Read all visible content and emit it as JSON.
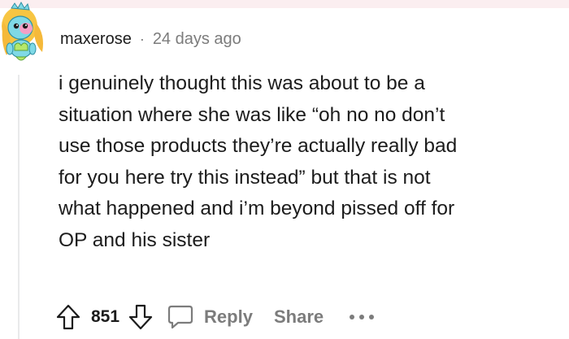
{
  "comment": {
    "username": "maxerose",
    "separator": "·",
    "timestamp": "24 days ago",
    "body": "i genuinely thought this was about to be a\nsituation where she was like “oh no no don’t\nuse those products they’re actually really bad\nfor you here try this instead” but that is not\nwhat happened and i’m beyond pissed off for\nOP and his sister",
    "avatar_icon": "snoo-avatar-icon"
  },
  "actions": {
    "upvote_icon": "upvote-arrow-icon",
    "vote_count": "851",
    "downvote_icon": "downvote-arrow-icon",
    "reply_icon": "speech-bubble-icon",
    "reply_label": "Reply",
    "share_label": "Share",
    "more_icon": "ellipsis-icon"
  },
  "colors": {
    "text_primary": "#1c1c1c",
    "text_muted": "#7c7c7c",
    "thread_line": "#e9eaeb",
    "avatar_body": "#7fd9e6",
    "avatar_hair": "#f7c542",
    "avatar_face": "#f59fc6"
  }
}
